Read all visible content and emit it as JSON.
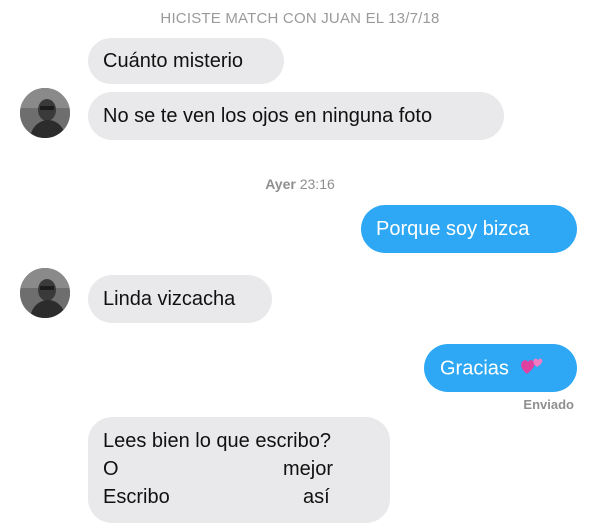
{
  "header": {
    "match_text": "HICISTE MATCH CON JUAN EL 13/7/18"
  },
  "messages": [
    {
      "text": "Cuánto misterio"
    },
    {
      "text": "No se te ven los ojos en ninguna foto"
    },
    {
      "text": "Porque soy bizca"
    },
    {
      "text": "Linda vizcacha"
    },
    {
      "text": "Gracias"
    },
    {
      "lines": [
        [
          "Lees bien lo que escribo?"
        ],
        [
          "O",
          "mejor"
        ],
        [
          "Escribo",
          "así"
        ]
      ]
    }
  ],
  "timestamp": {
    "day": "Ayer",
    "time": "23:16"
  },
  "status": {
    "sent_label": "Enviado"
  },
  "colors": {
    "incoming_bubble": "#e9e9eb",
    "outgoing_bubble": "#2ea8f5",
    "heart": "#e040a0"
  },
  "icons": {
    "avatar": "profile-photo-avatar",
    "heart": "two-hearts-emoji"
  }
}
